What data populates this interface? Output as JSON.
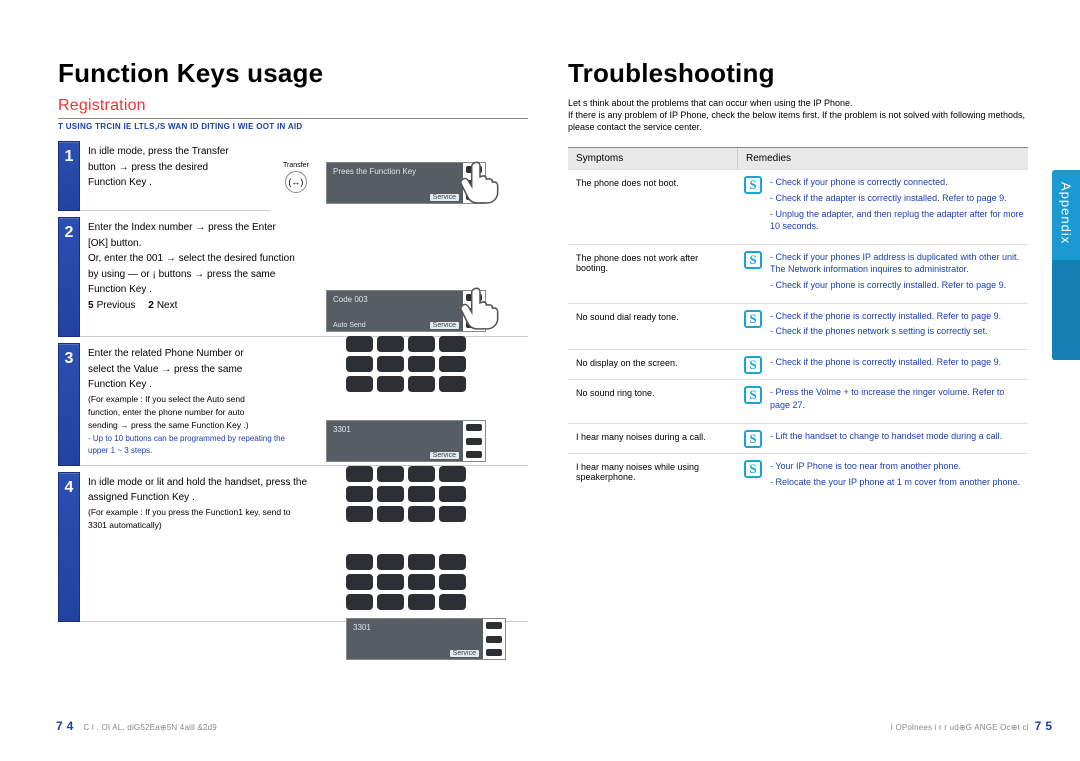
{
  "left": {
    "title": "Function Keys usage",
    "section": "Registration",
    "subnote": "T USING  TRCIN IE  LTLS,/S  WAN  ID  DITING     I WIE  OOT  IN  AID",
    "steps": [
      {
        "n": "1",
        "lines": [
          "In idle mode, press the Transfer",
          "button → press the desired",
          "Function Key  ."
        ],
        "transfer_label": "Transfer",
        "transfer_glyph": "(↔)",
        "lcd_top": "Prees the Function Key",
        "lcd_corner": "Service"
      },
      {
        "n": "2",
        "lines": [
          "Enter the Index number   → press the Enter",
          "[OK]  button.",
          "Or, enter the  001  → select the desired function",
          "by using — or  ¡ buttons → press the same",
          "Function Key  ."
        ],
        "kv": [
          {
            "k": "5",
            "v": "Previous"
          },
          {
            "k": "2",
            "v": "Next"
          }
        ],
        "lcd_top": "Code                           003",
        "lcd_sub": "Auto Send",
        "lcd_corner": "Service"
      },
      {
        "n": "3",
        "lines": [
          "Enter the related Phone Number   or",
          "select the Value → press the same",
          "Function Key  ."
        ],
        "tiny": [
          "(For example : If you select the Auto send",
          "function, enter the phone number  for auto",
          "sending → press the same  Function Key  .)"
        ],
        "bluewarn": [
          "- Up to 10 buttons can be programmed by repeating the",
          "  upper 1 ~ 3 steps."
        ],
        "lcd_top": "3301",
        "lcd_corner": "Service"
      },
      {
        "n": "4",
        "lines": [
          "In idle mode or lit and hold the handset, press the",
          "assigned Function Key   ."
        ],
        "tiny": [
          "(For example : If you press the Function1 key, send to",
          "3301  automatically)"
        ],
        "lcd_top": "3301",
        "lcd_corner": "Service"
      }
    ],
    "pagenum": "74",
    "footer": "C  I  . OI AL,   diG52Ea⊕5N  4alil  &2d9"
  },
  "right": {
    "title": "Troubleshooting",
    "intro": "Let s think about the problems that can occur when using the IP Phone.\nIf there is any problem of IP Phone, check the below items first. If the problem is not solved with following methods, please contact the service center.",
    "th1": "Symptoms",
    "th2": "Remedies",
    "rows": [
      {
        "sym": "The phone does not boot.",
        "rem": [
          "- Check if your phone is correctly connected.",
          "- Check if the adapter is correctly installed. Refer to page 9.",
          "- Unplug the adapter, and then replug the adapter after for more 10 seconds."
        ]
      },
      {
        "sym": "The phone does not work after booting.",
        "rem": [
          "- Check if your phones IP address is duplicated with other unit. The Network information inquires to administrator.",
          "- Check if your phone is correctly installed. Refer to page 9."
        ]
      },
      {
        "sym": "No sound dial ready tone.",
        "rem": [
          "- Check if the phone is correctly installed. Refer to page 9.",
          "- Check if the phones network s setting is correctly set."
        ]
      },
      {
        "sym": "No display on the screen.",
        "rem": [
          "- Check if the phone is correctly installed. Refer to page 9."
        ]
      },
      {
        "sym": "No sound ring tone.",
        "rem": [
          "- Press the Volme + to increase the ringer volume. Refer to page 27."
        ]
      },
      {
        "sym": "I hear many noises during a call.",
        "rem": [
          "- Lift  the handset to change to handset mode during a call."
        ]
      },
      {
        "sym": "I hear many noises while using speakerphone.",
        "rem": [
          "- Your IP Phone is too near from another phone.",
          "- Relocate the your IP phone at 1 m cover from another phone."
        ]
      }
    ],
    "tab": "Appendix",
    "pagenum": "75",
    "footer": "I OPolnees  i r  r ud⊕G  ANGE Oc⊕t cl"
  }
}
